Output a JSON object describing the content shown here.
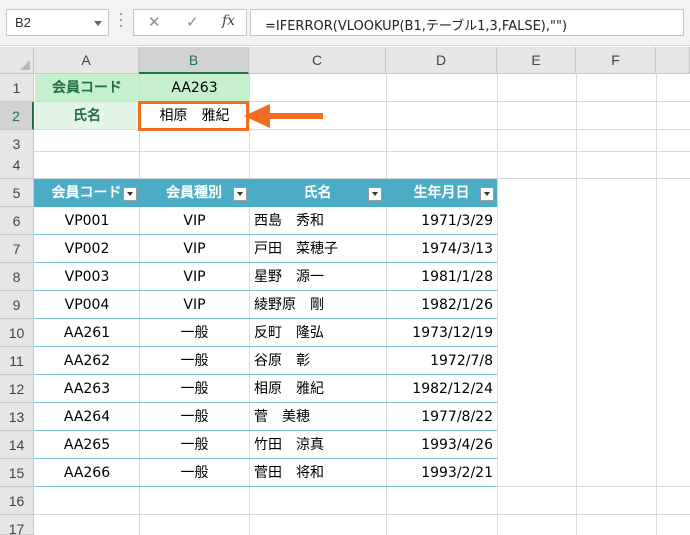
{
  "name_box": {
    "value": "B2"
  },
  "formula_bar": {
    "cancel_symbol": "✕",
    "enter_symbol": "✓",
    "fx_label": "fx",
    "formula": "=IFERROR(VLOOKUP(B1,テーブル1,3,FALSE),\"\")"
  },
  "columns": [
    "A",
    "B",
    "C",
    "D",
    "E",
    "F"
  ],
  "rows": [
    "1",
    "2",
    "3",
    "4",
    "5",
    "6",
    "7",
    "8",
    "9",
    "10",
    "11",
    "12",
    "13",
    "14",
    "15",
    "16",
    "17"
  ],
  "lookup": {
    "a1": "会員コード",
    "b1": "AA263",
    "a2": "氏名",
    "b2": "相原　雅紀"
  },
  "table": {
    "headers": [
      "会員コード",
      "会員種別",
      "氏名",
      "生年月日"
    ],
    "rows": [
      [
        "VP001",
        "VIP",
        "西島　秀和",
        "1971/3/29"
      ],
      [
        "VP002",
        "VIP",
        "戸田　菜穂子",
        "1974/3/13"
      ],
      [
        "VP003",
        "VIP",
        "星野　源一",
        "1981/1/28"
      ],
      [
        "VP004",
        "VIP",
        "綾野原　剛",
        "1982/1/26"
      ],
      [
        "AA261",
        "一般",
        "反町　隆弘",
        "1973/12/19"
      ],
      [
        "AA262",
        "一般",
        "谷原　彰",
        "1972/7/8"
      ],
      [
        "AA263",
        "一般",
        "相原　雅紀",
        "1982/12/24"
      ],
      [
        "AA264",
        "一般",
        "菅　美穂",
        "1977/8/22"
      ],
      [
        "AA265",
        "一般",
        "竹田　涼真",
        "1993/4/26"
      ],
      [
        "AA266",
        "一般",
        "菅田　将和",
        "1993/2/21"
      ]
    ]
  },
  "colors": {
    "table_header": "#4bacc6",
    "lookup_fill": "#c6efce",
    "annotation": "#f26c22",
    "excel_green": "#217346"
  }
}
